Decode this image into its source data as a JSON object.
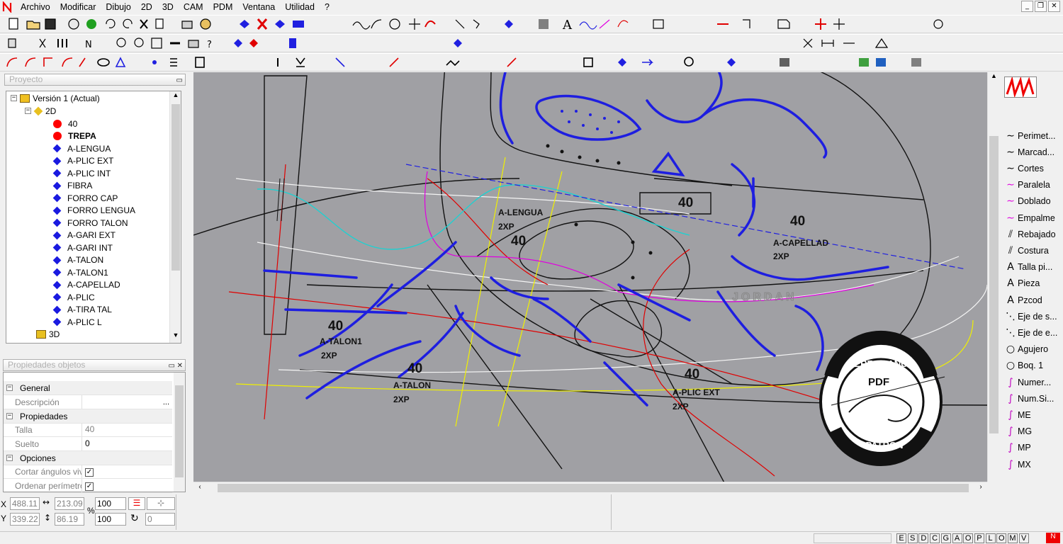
{
  "menu": {
    "items": [
      "Archivo",
      "Modificar",
      "Dibujo",
      "2D",
      "3D",
      "CAM",
      "PDM",
      "Ventana",
      "Utilidad",
      "?"
    ]
  },
  "window_controls": {
    "minimize": "_",
    "restore": "❐",
    "close": "✕"
  },
  "project_panel": {
    "title": "Proyecto",
    "root": "Versión 1 (Actual)",
    "node_2d": "2D",
    "items": [
      {
        "label": "40",
        "color": "red",
        "bold": false
      },
      {
        "label": "TREPA",
        "color": "red",
        "bold": true
      },
      {
        "label": "A-LENGUA",
        "color": "blue"
      },
      {
        "label": "A-PLIC EXT",
        "color": "blue"
      },
      {
        "label": "A-PLIC INT",
        "color": "blue"
      },
      {
        "label": "FIBRA",
        "color": "blue"
      },
      {
        "label": "FORRO CAP",
        "color": "blue"
      },
      {
        "label": "FORRO LENGUA",
        "color": "blue"
      },
      {
        "label": "FORRO TALON",
        "color": "blue"
      },
      {
        "label": "A-GARI EXT",
        "color": "blue"
      },
      {
        "label": "A-GARI INT",
        "color": "blue"
      },
      {
        "label": "A-TALON",
        "color": "blue"
      },
      {
        "label": "A-TALON1",
        "color": "blue"
      },
      {
        "label": "A-CAPELLAD",
        "color": "blue"
      },
      {
        "label": "A-PLIC",
        "color": "blue"
      },
      {
        "label": "A-TIRA TAL",
        "color": "blue"
      },
      {
        "label": "A-PLIC L",
        "color": "blue"
      }
    ],
    "node_3d": "3D"
  },
  "properties_panel": {
    "title": "Propiedades objetos",
    "general": "General",
    "descripcion_label": "Descripción",
    "descripcion_value": "",
    "propiedades": "Propiedades",
    "talla_label": "Talla",
    "talla_value": "40",
    "suelto_label": "Suelto",
    "suelto_value": "0",
    "opciones": "Opciones",
    "cortar_label": "Cortar ángulos vivos",
    "ordenar_label": "Ordenar perímetro",
    "ellipsis": "..."
  },
  "canvas": {
    "labels": [
      {
        "text": "40",
        "key": "size"
      },
      {
        "text": "A-LENGUA"
      },
      {
        "text": "2XP"
      },
      {
        "text": "A-CAPELLAD"
      },
      {
        "text": "A-TALON1"
      },
      {
        "text": "A-TALON"
      },
      {
        "text": "A-PLIC EXT"
      },
      {
        "text": "JORDAN"
      }
    ],
    "size_label": "40",
    "lengua": "A-LENGUA",
    "capellad": "A-CAPELLAD",
    "talon1": "A-TALON1",
    "talon": "A-TALON",
    "plic_ext": "A-PLIC EXT",
    "xp": "2XP",
    "jordan": "JORDAN"
  },
  "watermark": {
    "top": "PERFOMANCE",
    "center": "PDF",
    "bottom": "PATRON"
  },
  "right_tools": [
    {
      "label": "Perimet...",
      "icon": "curve-icon"
    },
    {
      "label": "Marcad...",
      "icon": "curve-icon"
    },
    {
      "label": "Cortes",
      "icon": "curve-icon"
    },
    {
      "label": "Paralela",
      "icon": "curve-pink-icon"
    },
    {
      "label": "Doblado",
      "icon": "curve-pink-icon"
    },
    {
      "label": "Empalme",
      "icon": "curve-pink-icon"
    },
    {
      "label": "Rebajado",
      "icon": "stitch-icon"
    },
    {
      "label": "Costura",
      "icon": "stitch-icon"
    },
    {
      "label": "Talla pi...",
      "icon": "text-icon"
    },
    {
      "label": "Pieza",
      "icon": "text-icon"
    },
    {
      "label": "Pzcod",
      "icon": "text-icon"
    },
    {
      "label": "Eje de s...",
      "icon": "axis-icon"
    },
    {
      "label": "Eje de e...",
      "icon": "axis-icon"
    },
    {
      "label": "Agujero",
      "icon": "circle-icon"
    },
    {
      "label": "Boq. 1",
      "icon": "circle-icon"
    },
    {
      "label": "Numer...",
      "icon": "mark-icon"
    },
    {
      "label": "Num.Si...",
      "icon": "mark-icon"
    },
    {
      "label": "ME",
      "icon": "mark-icon"
    },
    {
      "label": "MG",
      "icon": "mark-icon"
    },
    {
      "label": "MP",
      "icon": "mark-icon"
    },
    {
      "label": "MX",
      "icon": "mark-icon"
    }
  ],
  "coords": {
    "x_label": "X",
    "y_label": "Y",
    "x": "488.11",
    "y": "339.22",
    "dx": "213.09",
    "dy": "86.19",
    "pct_label": "%",
    "scale1": "100",
    "scale2": "100",
    "angle": "0"
  },
  "status_letters": [
    "E",
    "S",
    "D",
    "C",
    "G",
    "A",
    "O",
    "P",
    "L",
    "O",
    "M",
    "V"
  ],
  "colors": {
    "canvas_bg": "#a0a0a4",
    "pattern_blue": "#1e1ee0",
    "accent_red": "#e00000"
  }
}
